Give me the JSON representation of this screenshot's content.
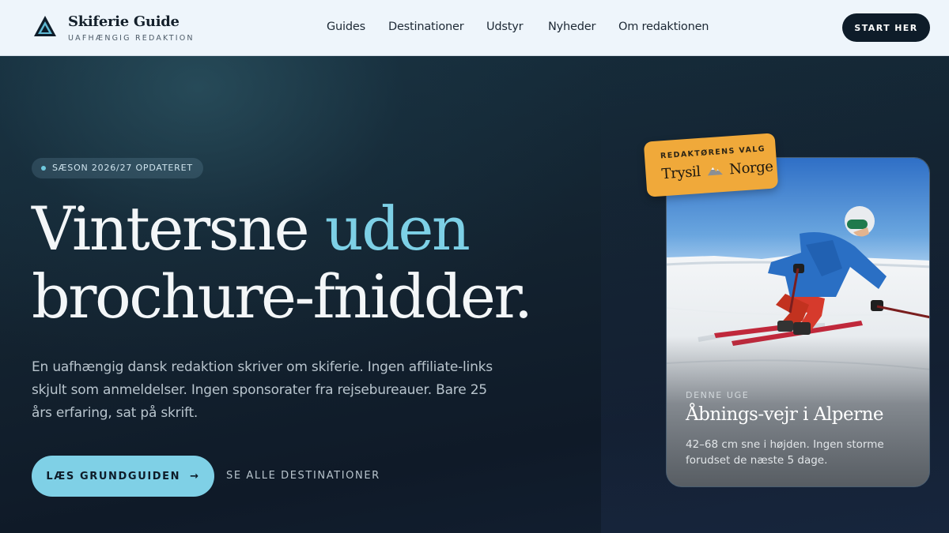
{
  "brand": {
    "name": "Skiferie Guide",
    "tagline": "UAFHÆNGIG REDAKTION",
    "logo_icon": "mountain-triangle-icon"
  },
  "nav": {
    "items": [
      {
        "label": "Guides"
      },
      {
        "label": "Destinationer"
      },
      {
        "label": "Udstyr"
      },
      {
        "label": "Nyheder"
      },
      {
        "label": "Om redaktionen"
      }
    ],
    "cta_label": "START HER"
  },
  "hero": {
    "badge": "SÆSON 2026/27 OPDATERET",
    "headline_line1": "Vintersne",
    "headline_accent": "uden",
    "headline_line2": "brochure-fnidder.",
    "lead": "En uafhængig dansk redaktion skriver om skiferie. Ingen affiliate-links skjult som anmeldelser. Ingen sponsorater fra rejsebureauer. Bare 25 års erfaring, sat på skrift.",
    "primary_cta": "LÆS GRUNDGUIDEN",
    "primary_cta_arrow": "→",
    "secondary_cta": "SE ALLE DESTINATIONER"
  },
  "sticker": {
    "label": "REDAKTØRENS VALG",
    "title_left": "Trysil",
    "title_right": "Norge",
    "icon": "mountain-icon"
  },
  "card": {
    "kicker": "DENNE UGE",
    "title": "Åbnings-vejr i Alperne",
    "text": "42–68 cm sne i højden. Ingen storme forudset de næste 5 dage.",
    "image": "skier-photo"
  },
  "colors": {
    "accent": "#7dd0e6",
    "dark": "#0e1c29",
    "sticker": "#f0a93a",
    "header_bg": "#eef5fb"
  }
}
